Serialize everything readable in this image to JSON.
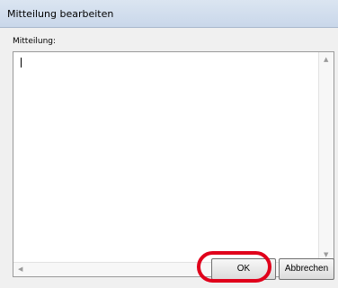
{
  "window": {
    "title": "Mitteilung bearbeiten"
  },
  "form": {
    "label": "Mitteilung:",
    "value": ""
  },
  "buttons": {
    "ok": "OK",
    "cancel": "Abbrechen"
  },
  "icons": {
    "up": "▲",
    "down": "▼",
    "left": "◀",
    "right": "▶"
  },
  "colors": {
    "highlight_ring": "#e0001b"
  }
}
